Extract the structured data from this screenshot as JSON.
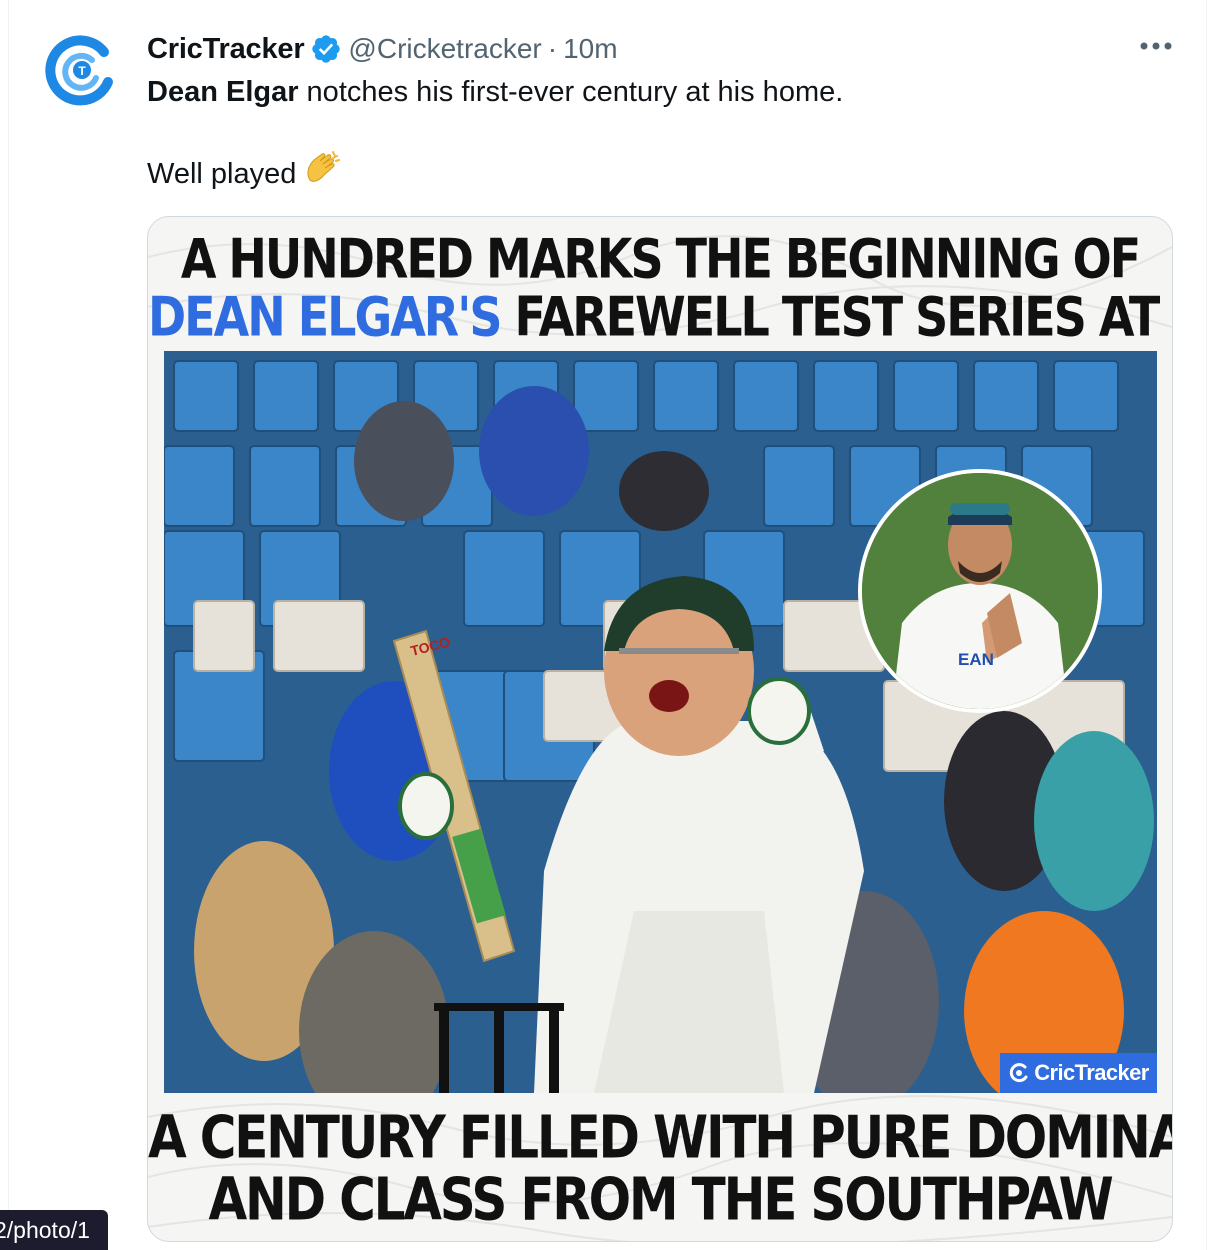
{
  "tweet": {
    "author": {
      "display_name": "CricTracker",
      "verified_icon": "verified-badge-icon",
      "handle": "@Cricketracker",
      "avatar_icon": "crictracker-logo"
    },
    "separator": "·",
    "time": "10m",
    "more_icon": "more-horizontal-icon",
    "text": {
      "bold_name": "Dean Elgar",
      "line1_rest": " notches his first-ever century at his home.",
      "line2": "Well played",
      "emoji_icon": "clapping-hands-icon"
    },
    "media": {
      "headline_line1": "A HUNDRED MARKS THE BEGINNING OF",
      "headline_accent": "DEAN ELGAR'S",
      "headline_line2_rest": " FAREWELL TEST SERIES AT HIS HOME",
      "watermark": "CricTracker",
      "bat_brand": "TOCO",
      "inset_text": "EAN",
      "bottom_line1": "A CENTURY FILLED WITH PURE DOMINATION",
      "bottom_line2": "AND CLASS FROM THE SOUTHPAW"
    }
  },
  "status_url": "2/photo/1",
  "colors": {
    "accent": "#2f6ce0",
    "verified": "#1d9bf0",
    "secondary_text": "#536471",
    "stand_seats": "#3a86c8"
  }
}
